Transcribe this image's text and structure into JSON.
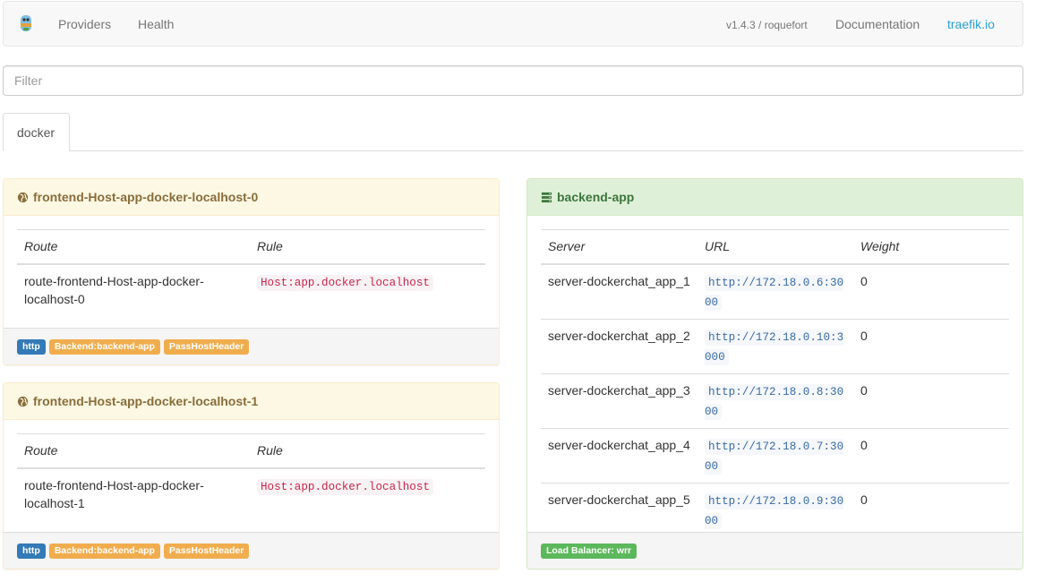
{
  "navbar": {
    "links": {
      "providers": "Providers",
      "health": "Health",
      "version": "v1.4.3 / roquefort",
      "documentation": "Documentation",
      "traefik": "traefik.io"
    }
  },
  "filter": {
    "placeholder": "Filter",
    "value": ""
  },
  "tabs": [
    {
      "label": "docker",
      "active": true
    }
  ],
  "frontends": [
    {
      "title": "frontend-Host-app-docker-localhost-0",
      "headers": {
        "route": "Route",
        "rule": "Rule"
      },
      "rows": [
        {
          "route": "route-frontend-Host-app-docker-localhost-0",
          "rule": "Host:app.docker.localhost"
        }
      ],
      "labels": [
        "http",
        "Backend:backend-app",
        "PassHostHeader"
      ]
    },
    {
      "title": "frontend-Host-app-docker-localhost-1",
      "headers": {
        "route": "Route",
        "rule": "Rule"
      },
      "rows": [
        {
          "route": "route-frontend-Host-app-docker-localhost-1",
          "rule": "Host:app.docker.localhost"
        }
      ],
      "labels": [
        "http",
        "Backend:backend-app",
        "PassHostHeader"
      ]
    }
  ],
  "backend": {
    "title": "backend-app",
    "headers": {
      "server": "Server",
      "url": "URL",
      "weight": "Weight"
    },
    "servers": [
      {
        "name": "server-dockerchat_app_1",
        "url": "http://172.18.0.6:3000",
        "weight": "0"
      },
      {
        "name": "server-dockerchat_app_2",
        "url": "http://172.18.0.10:3000",
        "weight": "0"
      },
      {
        "name": "server-dockerchat_app_3",
        "url": "http://172.18.0.8:3000",
        "weight": "0"
      },
      {
        "name": "server-dockerchat_app_4",
        "url": "http://172.18.0.7:3000",
        "weight": "0"
      },
      {
        "name": "server-dockerchat_app_5",
        "url": "http://172.18.0.9:3000",
        "weight": "0"
      }
    ],
    "load_balancer": "Load Balancer: wrr"
  },
  "colors": {
    "warning_heading": "#fcf8e3",
    "success_heading": "#dff0d8",
    "label_primary": "#337ab7",
    "label_warning": "#f0ad4e",
    "label_success": "#5cb85c",
    "link": "#2aa0d6"
  },
  "icons": {
    "logo": "traefik-gopher-icon",
    "frontend": "globe-icon",
    "backend": "server-icon"
  }
}
